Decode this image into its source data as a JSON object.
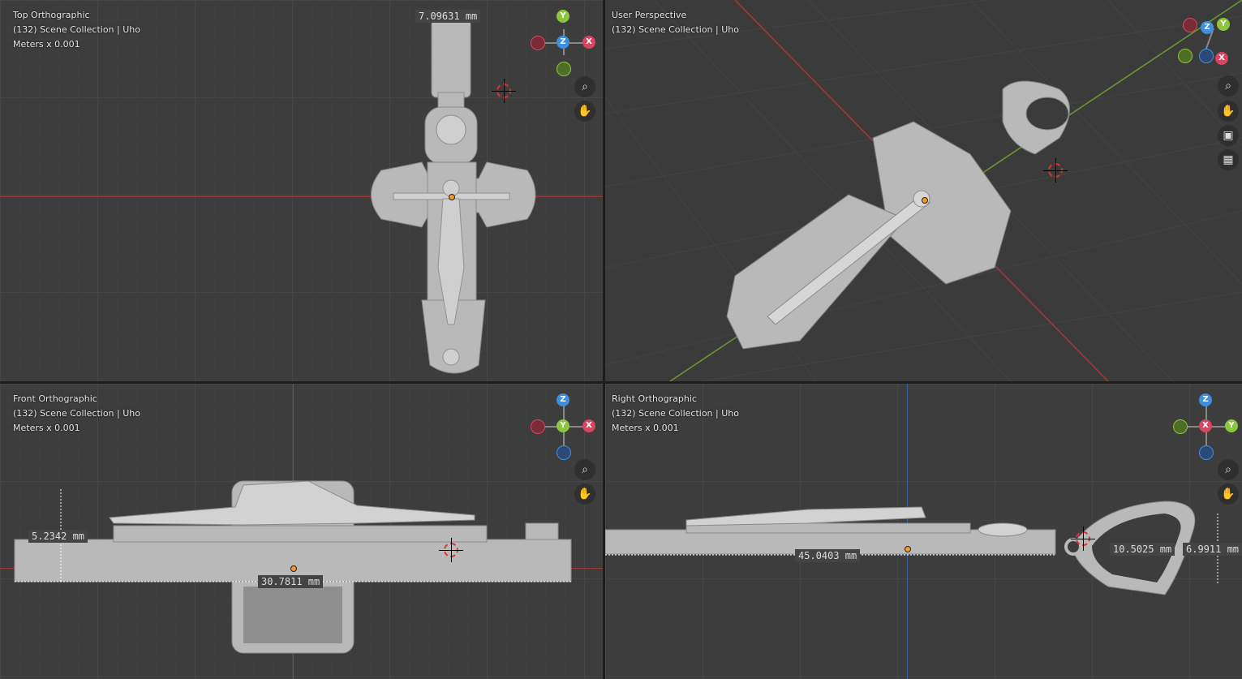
{
  "viewports": {
    "top": {
      "title": "Top Orthographic",
      "collection": "(132) Scene Collection | Uho",
      "units": "Meters x 0.001",
      "measure": "7.09631 mm"
    },
    "user": {
      "title": "User Perspective",
      "collection": "(132) Scene Collection | Uho"
    },
    "front": {
      "title": "Front Orthographic",
      "collection": "(132) Scene Collection | Uho",
      "units": "Meters x 0.001",
      "measure_height": "5.2342 mm",
      "measure_width": "30.7811 mm"
    },
    "right": {
      "title": "Right Orthographic",
      "collection": "(132) Scene Collection | Uho",
      "units": "Meters x 0.001",
      "measure_length": "45.0403 mm",
      "measure_loop": "10.5025 mm",
      "measure_loop2": "6.9911 mm"
    }
  },
  "gizmo": {
    "x": "X",
    "y": "Y",
    "z": "Z"
  },
  "colors": {
    "x_axis": "#d9455f",
    "y_axis": "#8cc63f",
    "z_axis": "#3d8fe0",
    "model": "#b8b8b8",
    "grid": "#3d3d3d"
  },
  "icons": [
    "zoom-icon",
    "pan-hand-icon",
    "camera-icon",
    "grid-projection-icon"
  ]
}
